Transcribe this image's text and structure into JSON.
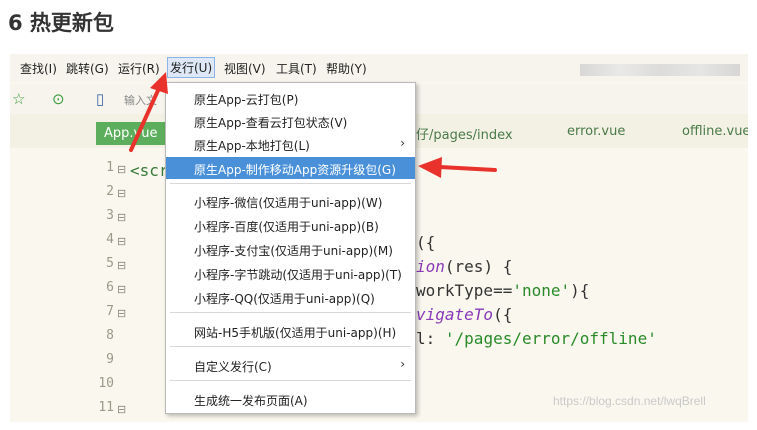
{
  "heading": "6 热更新包",
  "menubar": {
    "items": [
      "查找(I)",
      "跳转(G)",
      "运行(R)",
      "发行(U)",
      "视图(V)",
      "工具(T)",
      "帮助(Y)"
    ]
  },
  "toolbar": {
    "search_placeholder": "输入文"
  },
  "tabs": [
    "App.vue",
    "仔/pages/index",
    "error.vue",
    "offline.vue"
  ],
  "editor": {
    "lines": [
      {
        "n": "1",
        "fold": "⊟",
        "code": "<scr"
      },
      {
        "n": "2",
        "fold": "⊟",
        "code": ""
      },
      {
        "n": "3",
        "fold": "⊟",
        "code": ""
      },
      {
        "n": "4",
        "fold": "⊟",
        "code": "({"
      },
      {
        "n": "5",
        "fold": "⊟",
        "code": "ion(res) {"
      },
      {
        "n": "6",
        "fold": "⊟",
        "code": "workType=='none'){"
      },
      {
        "n": "7",
        "fold": "⊟",
        "code": "vigateTo({"
      },
      {
        "n": "8",
        "fold": "",
        "code": "l: '/pages/error/offline'"
      },
      {
        "n": "9",
        "fold": "",
        "code": ""
      },
      {
        "n": "10",
        "fold": "",
        "code": ""
      },
      {
        "n": "11",
        "fold": "⊟",
        "code": ""
      }
    ]
  },
  "menu": {
    "items": [
      "原生App-云打包(P)",
      "原生App-查看云打包状态(V)",
      "原生App-本地打包(L)",
      "原生App-制作移动App资源升级包(G)",
      "小程序-微信(仅适用于uni-app)(W)",
      "小程序-百度(仅适用于uni-app)(B)",
      "小程序-支付宝(仅适用于uni-app)(M)",
      "小程序-字节跳动(仅适用于uni-app)(T)",
      "小程序-QQ(仅适用于uni-app)(Q)",
      "网站-H5手机版(仅适用于uni-app)(H)",
      "自定义发行(C)",
      "生成统一发布页面(A)"
    ]
  },
  "watermark": "https://blog.csdn.net/lwqBrell",
  "colors": {
    "accent": "#4a90d9",
    "tab_active": "#5cae5c",
    "arrow": "#e8322b"
  }
}
